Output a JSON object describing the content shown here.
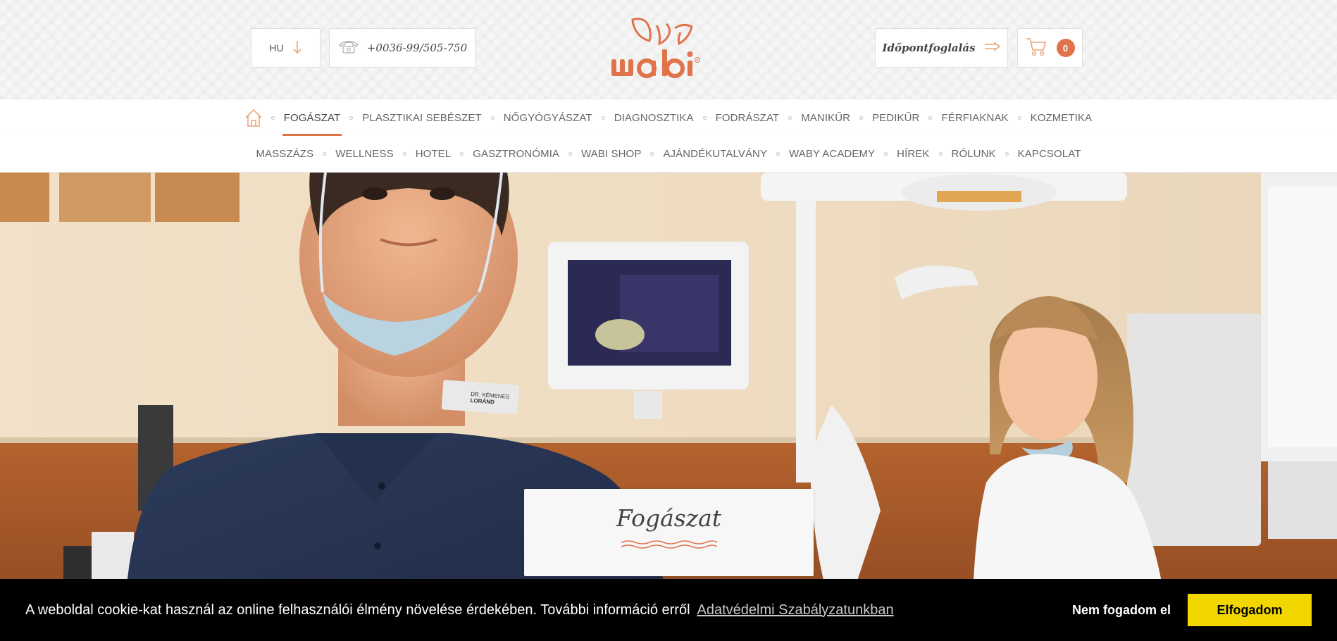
{
  "header": {
    "language": "HU",
    "phone": "+0036-99/505-750",
    "booking_label": "Időpontfoglalás",
    "cart_count": "0",
    "logo_text": "wabi"
  },
  "nav": {
    "row1": [
      "FOGÁSZAT",
      "PLASZTIKAI SEBÉSZET",
      "NŐGYÓGYÁSZAT",
      "DIAGNOSZTIKA",
      "FODRÁSZAT",
      "MANIKŰR",
      "PEDIKŰR",
      "FÉRFIAKNAK",
      "KOZMETIKA"
    ],
    "row2": [
      "MASSZÁZS",
      "WELLNESS",
      "HOTEL",
      "GASZTRONÓMIA",
      "WABI SHOP",
      "AJÁNDÉKUTALVÁNY",
      "WABY ACADEMY",
      "HÍREK",
      "RÓLUNK",
      "KAPCSOLAT"
    ],
    "active": "FOGÁSZAT"
  },
  "hero": {
    "title": "Fogászat",
    "badge_line1": "DR. KÉMENES",
    "badge_line2": "LORÁND"
  },
  "cookie": {
    "message": "A weboldal cookie-kat használ az online felhasználói élmény növelése érdekében. További információ erről",
    "link": "Adatvédelmi Szabályzatunkban",
    "deny": "Nem fogadom el",
    "accept": "Elfogadom"
  },
  "colors": {
    "accent": "#e0734a",
    "cookie_bg": "#000000",
    "accept_bg": "#f1d600"
  }
}
